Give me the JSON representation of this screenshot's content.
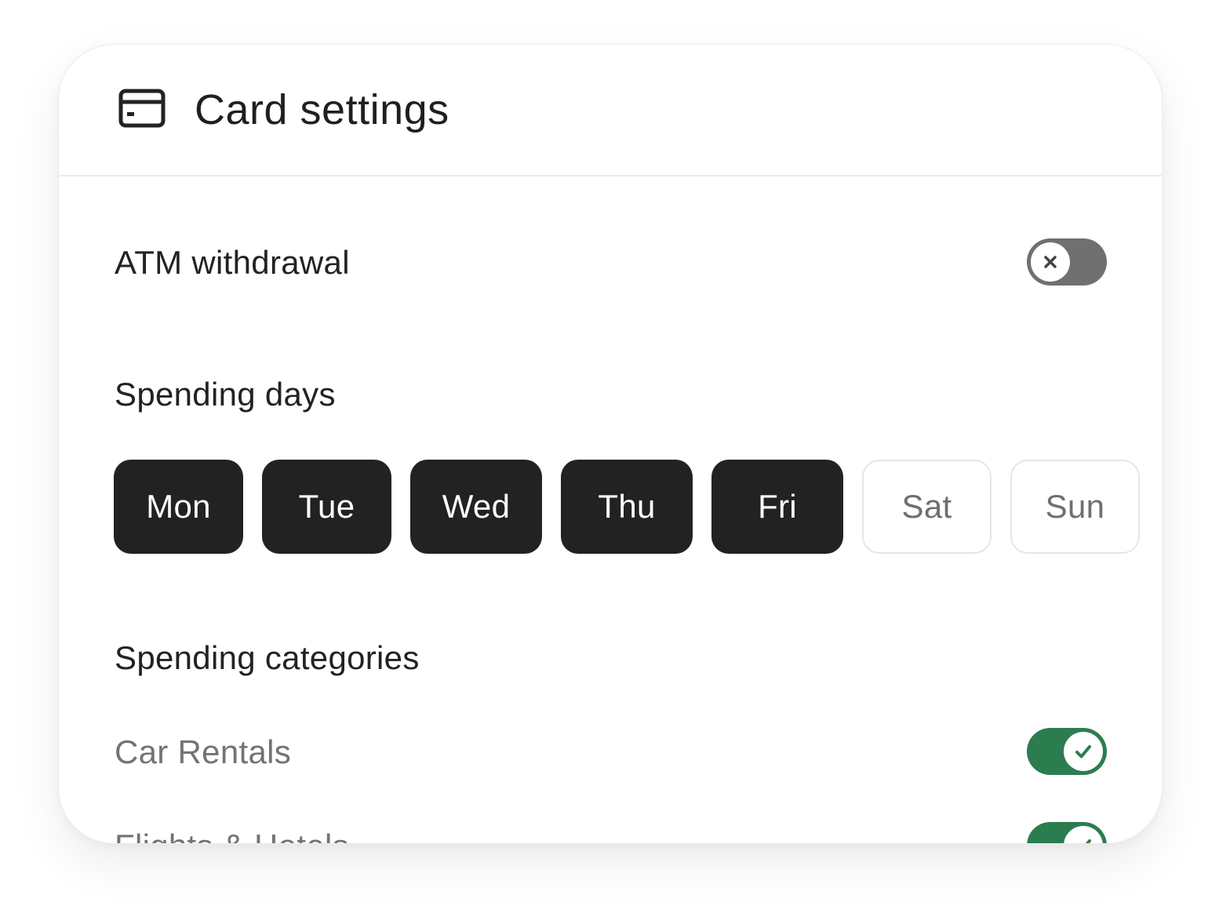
{
  "header": {
    "title": "Card settings",
    "icon": "credit-card-icon"
  },
  "atm": {
    "label": "ATM withdrawal",
    "enabled": false
  },
  "spending_days": {
    "label": "Spending days",
    "days": [
      {
        "label": "Mon",
        "selected": true
      },
      {
        "label": "Tue",
        "selected": true
      },
      {
        "label": "Wed",
        "selected": true
      },
      {
        "label": "Thu",
        "selected": true
      },
      {
        "label": "Fri",
        "selected": true
      },
      {
        "label": "Sat",
        "selected": false
      },
      {
        "label": "Sun",
        "selected": false
      }
    ]
  },
  "spending_categories": {
    "label": "Spending categories",
    "items": [
      {
        "label": "Car Rentals",
        "enabled": true
      },
      {
        "label": "Flights & Hotels",
        "enabled": true
      }
    ]
  },
  "colors": {
    "toggle_on": "#2b7d4f",
    "toggle_off": "#707070",
    "day_selected": "#222222"
  }
}
